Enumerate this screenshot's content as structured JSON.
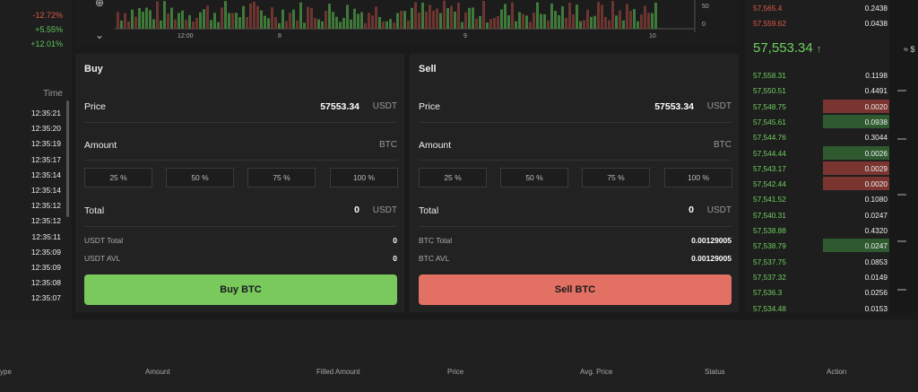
{
  "market_changes": [
    "-12.72%",
    "+5.55%",
    "+12.01%"
  ],
  "time_header": "Time",
  "times": [
    "12:35:21",
    "12:35:20",
    "12:35:19",
    "12:35:17",
    "12:35:14",
    "12:35:14",
    "12:35:12",
    "12:35:12",
    "12:35:11",
    "12:35:09",
    "12:35:09",
    "12:35:08",
    "12:35:07"
  ],
  "chart": {
    "x_labels": [
      "12:00",
      "8",
      "9",
      "10"
    ],
    "y_labels": [
      "50",
      "0"
    ]
  },
  "buy": {
    "title": "Buy",
    "price_label": "Price",
    "price_value": "57553.34",
    "price_unit": "USDT",
    "amount_label": "Amount",
    "amount_unit": "BTC",
    "pct": [
      "25 %",
      "50 %",
      "75 %",
      "100 %"
    ],
    "total_label": "Total",
    "total_value": "0",
    "total_unit": "USDT",
    "balance_total_label": "USDT Total",
    "balance_total_value": "0",
    "balance_avl_label": "USDT AVL",
    "balance_avl_value": "0",
    "button": "Buy BTC"
  },
  "sell": {
    "title": "Sell",
    "price_label": "Price",
    "price_value": "57553.34",
    "price_unit": "USDT",
    "amount_label": "Amount",
    "amount_unit": "BTC",
    "pct": [
      "25 %",
      "50 %",
      "75 %",
      "100 %"
    ],
    "total_label": "Total",
    "total_value": "0",
    "total_unit": "USDT",
    "balance_total_label": "BTC Total",
    "balance_total_value": "0.00129005",
    "balance_avl_label": "BTC AVL",
    "balance_avl_value": "0.00129005",
    "button": "Sell BTC"
  },
  "orderbook": {
    "asks": [
      {
        "price": "57,565.4",
        "qty": "0.2438"
      },
      {
        "price": "57,559.62",
        "qty": "0.0438"
      }
    ],
    "last_price": "57,553.34",
    "last_arrow": "↑",
    "last_usd": "≈ $",
    "bids": [
      {
        "price": "57,558.31",
        "qty": "0.1198",
        "bar": ""
      },
      {
        "price": "57,550.51",
        "qty": "0.4491",
        "bar": ""
      },
      {
        "price": "57,548.75",
        "qty": "0.0020",
        "bar": "red"
      },
      {
        "price": "57,545.61",
        "qty": "0.0938",
        "bar": "green"
      },
      {
        "price": "57,544.76",
        "qty": "0.3044",
        "bar": ""
      },
      {
        "price": "57,544.44",
        "qty": "0.0026",
        "bar": "green"
      },
      {
        "price": "57,543.17",
        "qty": "0.0029",
        "bar": "red"
      },
      {
        "price": "57,542.44",
        "qty": "0.0020",
        "bar": "red"
      },
      {
        "price": "57,541.52",
        "qty": "0.1080",
        "bar": ""
      },
      {
        "price": "57,540.31",
        "qty": "0.0247",
        "bar": ""
      },
      {
        "price": "57,538.88",
        "qty": "0.4320",
        "bar": ""
      },
      {
        "price": "57,538.79",
        "qty": "0.0247",
        "bar": "green"
      },
      {
        "price": "57,537.75",
        "qty": "0.0853",
        "bar": ""
      },
      {
        "price": "57,537.32",
        "qty": "0.0149",
        "bar": ""
      },
      {
        "price": "57,536.3",
        "qty": "0.0256",
        "bar": ""
      },
      {
        "price": "57,534.48",
        "qty": "0.0153",
        "bar": ""
      }
    ]
  },
  "orders_table": {
    "columns": [
      "ype",
      "Amount",
      "Filled Amount",
      "Price",
      "Avg. Price",
      "Status",
      "Action"
    ]
  }
}
